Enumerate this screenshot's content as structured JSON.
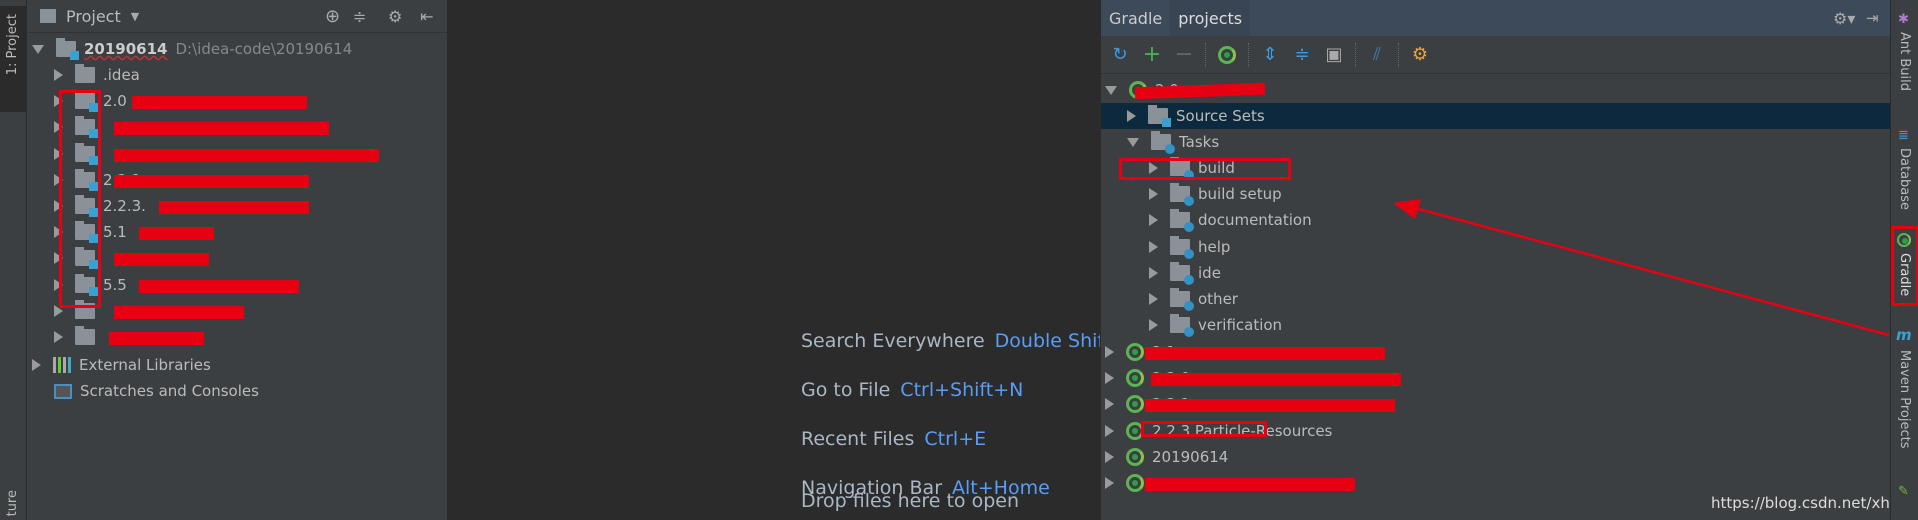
{
  "left_stripe": {
    "project_tab": "1: Project",
    "structure_tab": "ture"
  },
  "project_panel": {
    "title": "Project",
    "root": {
      "name": "20190614",
      "path": "D:\\idea-code\\20190614"
    },
    "items": [
      {
        "label": ".idea",
        "module": false
      },
      {
        "label": "2.0",
        "module": true
      },
      {
        "label": "",
        "module": true
      },
      {
        "label": "",
        "module": true
      },
      {
        "label": "2.2.1",
        "module": true
      },
      {
        "label": "2.2.3.",
        "module": true
      },
      {
        "label": "5.1",
        "module": true
      },
      {
        "label": "",
        "module": true
      },
      {
        "label": "5.5",
        "module": true
      },
      {
        "label": "",
        "module": false
      },
      {
        "label": "",
        "module": false
      }
    ],
    "external_libraries": "External Libraries",
    "scratches": "Scratches and Consoles"
  },
  "editor": {
    "hints": [
      {
        "action": "Search Everywhere",
        "key": "Double Shift"
      },
      {
        "action": "Go to File",
        "key": "Ctrl+Shift+N"
      },
      {
        "action": "Recent Files",
        "key": "Ctrl+E"
      },
      {
        "action": "Navigation Bar",
        "key": "Alt+Home"
      }
    ],
    "drop_text": "Drop files here to open"
  },
  "gradle_panel": {
    "tabs": [
      "Gradle",
      "projects"
    ],
    "tree": {
      "first_project": "2.0",
      "source_sets": "Source Sets",
      "tasks": "Tasks",
      "task_groups": [
        "build",
        "build setup",
        "documentation",
        "help",
        "ide",
        "other",
        "verification"
      ],
      "other_projects": [
        "2.1",
        "2.2.0",
        "2.2.1",
        "2.2.3.Particle-Resources",
        "20190614",
        ""
      ]
    }
  },
  "right_stripe": {
    "tabs": [
      "Ant Build",
      "Database",
      "Gradle",
      "Maven Projects"
    ]
  },
  "watermark": "https://blog.csdn.net/xhangs",
  "colors": {
    "accent": "#589df6",
    "annotation": "#e60012",
    "selection": "#0d293e"
  }
}
